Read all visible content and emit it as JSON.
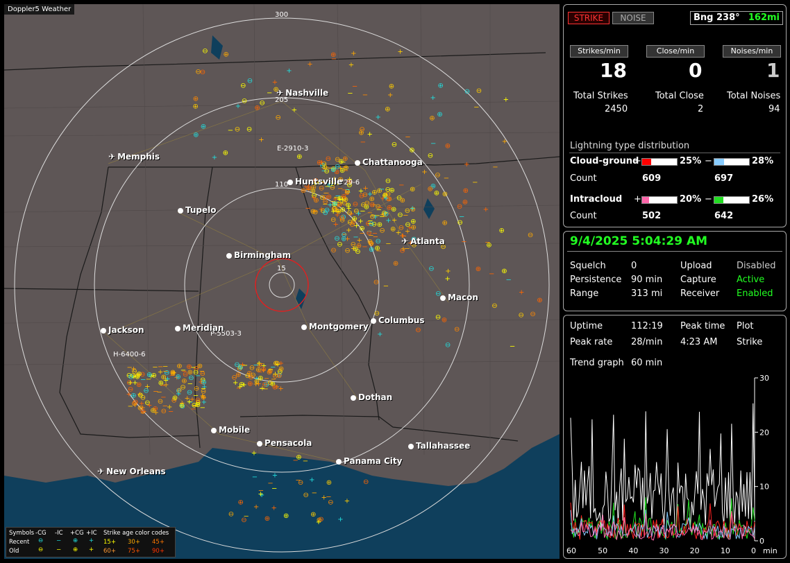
{
  "map": {
    "title": "Doppler5 Weather",
    "range_labels": [
      "300",
      "205",
      "110",
      "15"
    ],
    "strike_labels": [
      "E-2910-3",
      "729-6",
      "P-5503-3",
      "H-6400-6"
    ],
    "cities": [
      {
        "name": "Nashville",
        "type": "plane"
      },
      {
        "name": "Memphis",
        "type": "plane"
      },
      {
        "name": "Chattanooga",
        "type": "dot"
      },
      {
        "name": "Huntsville",
        "type": "dot"
      },
      {
        "name": "Tupelo",
        "type": "dot"
      },
      {
        "name": "Atlanta",
        "type": "plane"
      },
      {
        "name": "Birmingham",
        "type": "dot"
      },
      {
        "name": "Macon",
        "type": "dot"
      },
      {
        "name": "Jackson",
        "type": "dot"
      },
      {
        "name": "Meridian",
        "type": "dot"
      },
      {
        "name": "Montgomery",
        "type": "dot"
      },
      {
        "name": "Columbus",
        "type": "dot"
      },
      {
        "name": "Dothan",
        "type": "dot"
      },
      {
        "name": "Mobile",
        "type": "dot"
      },
      {
        "name": "Pensacola",
        "type": "dot"
      },
      {
        "name": "Tallahassee",
        "type": "dot"
      },
      {
        "name": "Panama City",
        "type": "dot"
      },
      {
        "name": "New Orleans",
        "type": "plane"
      }
    ],
    "legend": {
      "symbols_label": "Symbols",
      "cols": [
        "-CG",
        "-IC",
        "+CG",
        "+IC"
      ],
      "age_title": "Strike age color codes",
      "recent_label": "Recent",
      "old_label": "Old",
      "recent_ages": [
        "15+",
        "30+",
        "45+"
      ],
      "old_ages": [
        "60+",
        "75+",
        "90+"
      ],
      "age_colors": [
        "#ffff00",
        "#ffaa00",
        "#ff7700",
        "#ff9933",
        "#ff5500",
        "#ff3300"
      ]
    }
  },
  "top": {
    "strike_btn": "STRIKE",
    "noise_btn": "NOISE",
    "bearing": "Bng 238°",
    "distance": "162mi",
    "heads": [
      "Strikes/min",
      "Close/min",
      "Noises/min"
    ],
    "values": [
      "18",
      "0",
      "1"
    ],
    "totals_labels": [
      "Total Strikes",
      "Total Close",
      "Total Noises"
    ],
    "totals_values": [
      "2450",
      "2",
      "94"
    ]
  },
  "dist": {
    "title": "Lightning type distribution",
    "cg_label": "Cloud-ground",
    "ic_label": "Intracloud",
    "count_label": "Count",
    "plus": "+",
    "minus": "−",
    "cg_pos_pct": "25%",
    "cg_neg_pct": "28%",
    "cg_pos_count": "609",
    "cg_neg_count": "697",
    "ic_pos_pct": "20%",
    "ic_neg_pct": "26%",
    "ic_pos_count": "502",
    "ic_neg_count": "642",
    "cg_pos_frac": 0.25,
    "cg_neg_frac": 0.28,
    "ic_pos_frac": 0.2,
    "ic_neg_frac": 0.26,
    "colors": {
      "cg_pos": "#ff0000",
      "cg_neg": "#88ccff",
      "ic_pos": "#ff66aa",
      "ic_neg": "#22dd22"
    }
  },
  "status": {
    "datetime": "9/4/2025 5:04:29 AM",
    "squelch_label": "Squelch",
    "squelch": "0",
    "persist_label": "Persistence",
    "persist": "90 min",
    "range_label": "Range",
    "range": "313 mi",
    "upload_label": "Upload",
    "upload": "Disabled",
    "capture_label": "Capture",
    "capture": "Active",
    "receiver_label": "Receiver",
    "receiver": "Enabled"
  },
  "trend": {
    "uptime_label": "Uptime",
    "uptime": "112:19",
    "peaktime_label": "Peak time",
    "peaktime": "4:23 AM",
    "plot_label": "Plot",
    "peakrate_label": "Peak rate",
    "peakrate": "28/min",
    "plot_value": "Strike",
    "graph_label": "Trend graph",
    "graph_window": "60 min",
    "y_ticks": [
      "30",
      "20",
      "10",
      "0"
    ],
    "x_ticks": [
      "60",
      "50",
      "40",
      "30",
      "20",
      "10",
      "0"
    ],
    "x_unit": "min"
  }
}
